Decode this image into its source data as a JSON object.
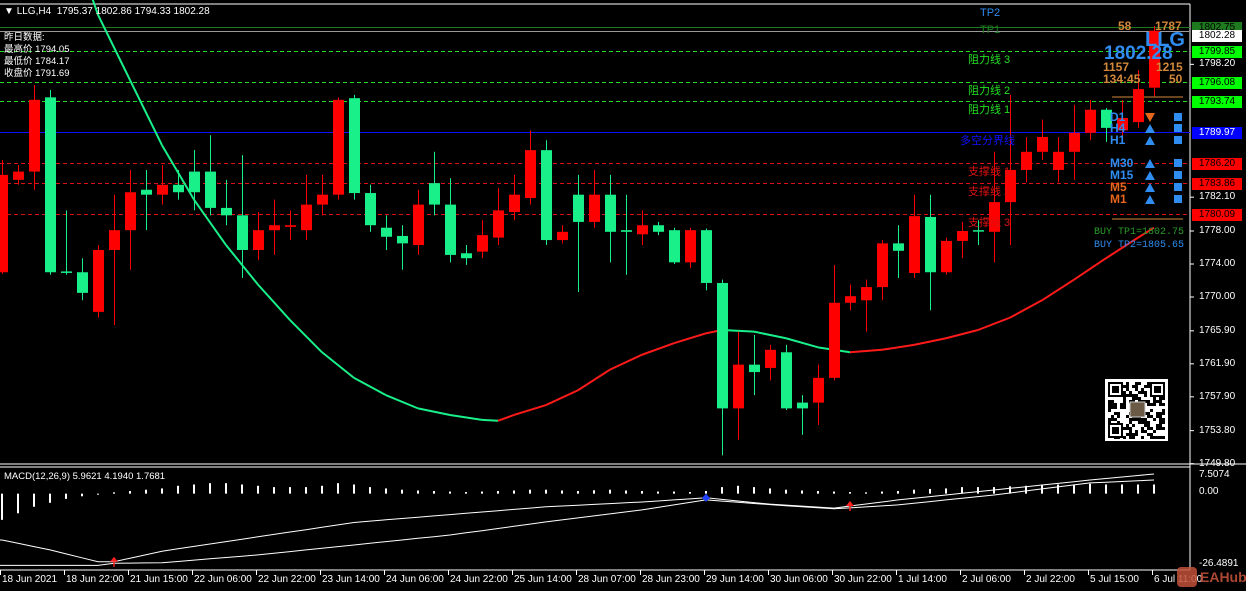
{
  "header": {
    "symbol": "LLG,H4",
    "open": "1795.37",
    "high": "1802.86",
    "low": "1794.33",
    "close": "1802.28"
  },
  "yesterday": {
    "title": "昨日数据:",
    "high": "最高价 1794.05",
    "low": "最低价 1784.17",
    "close": "收盘价 1791.69"
  },
  "levels": [
    {
      "label": "TP2",
      "price": 1805.65,
      "color": "#2f8cf0",
      "line": false,
      "axis_label": null
    },
    {
      "label": "TP1",
      "price": 1802.75,
      "color": "#1e7a1e",
      "line": "solid",
      "axis_label": "1802.75",
      "box": "#1e7a1e"
    },
    {
      "label": "",
      "price": 1802.28,
      "color": "#9a9a9a",
      "line": "solid",
      "axis_label": "1802.28",
      "box": "#ffffff"
    },
    {
      "label": "阻力线 3",
      "price": 1799.85,
      "color": "#22dd22",
      "line": "dashed",
      "axis_label": "1799.85",
      "box": "#00ff00"
    },
    {
      "label": "阻力线 2",
      "price": 1796.08,
      "color": "#22dd22",
      "line": "dashed",
      "axis_label": "1796.08",
      "box": "#00ff00"
    },
    {
      "label": "阻力线 1",
      "price": 1793.74,
      "color": "#22dd22",
      "line": "dashed",
      "axis_label": "1793.74",
      "box": "#00ff00"
    },
    {
      "label": "多空分界线",
      "price": 1789.97,
      "color": "#1010ff",
      "line": "solid",
      "axis_label": "1789.97",
      "box": "#0000ff"
    },
    {
      "label": "支撑线 1",
      "price": 1786.2,
      "color": "#dd1111",
      "line": "dashed",
      "axis_label": "1786.20",
      "box": "#ff0000"
    },
    {
      "label": "支撑线 2",
      "price": 1783.86,
      "color": "#dd1111",
      "line": "dashed",
      "axis_label": "1783.86",
      "box": "#ff0000"
    },
    {
      "label": "支撑线 3",
      "price": 1780.09,
      "color": "#dd1111",
      "line": "dashed",
      "axis_label": "1780.09",
      "box": "#ff0000"
    }
  ],
  "price_axis": [
    "1798.20",
    "1782.10",
    "1778.00",
    "1774.00",
    "1770.00",
    "1765.90",
    "1761.90",
    "1757.90",
    "1753.80",
    "1749.80"
  ],
  "info_panel": {
    "symbol": "LLG",
    "price": "1802.28",
    "n1": "58",
    "n2": "1787",
    "n3": "1157",
    "n4": "1215",
    "timer": "134:45",
    "n5": "50"
  },
  "timeframes": [
    {
      "label": "D1",
      "color": "#2f8cf0",
      "dir": "down",
      "arrow_color": "#e8661c"
    },
    {
      "label": "H4",
      "color": "#2f8cf0",
      "dir": "up",
      "arrow_color": "#2f8cf0"
    },
    {
      "label": "H1",
      "color": "#2f8cf0",
      "dir": "up",
      "arrow_color": "#2f8cf0"
    },
    {
      "label": "M30",
      "color": "#2f8cf0",
      "dir": "up",
      "arrow_color": "#2f8cf0"
    },
    {
      "label": "M15",
      "color": "#2f8cf0",
      "dir": "up",
      "arrow_color": "#2f8cf0"
    },
    {
      "label": "M5",
      "color": "#e8661c",
      "dir": "up",
      "arrow_color": "#2f8cf0"
    },
    {
      "label": "M1",
      "color": "#e8661c",
      "dir": "up",
      "arrow_color": "#2f8cf0"
    }
  ],
  "buy_tp": {
    "tp1": "BUY TP1=1802.75",
    "tp2": "BUY TP2=1805.65"
  },
  "macd": {
    "title": "MACD(12,26,9) 5.9621 4.1940 1.7681",
    "axis_top": "7.5074",
    "axis_zero": "0.00",
    "axis_bottom": "-26.4891"
  },
  "time_axis": [
    "18 Jun 2021",
    "18 Jun 22:00",
    "21 Jun 15:00",
    "22 Jun 06:00",
    "22 Jun 22:00",
    "23 Jun 14:00",
    "24 Jun 06:00",
    "24 Jun 22:00",
    "25 Jun 14:00",
    "28 Jun 07:00",
    "28 Jun 23:00",
    "29 Jun 14:00",
    "30 Jun 06:00",
    "30 Jun 22:00",
    "1 Jul 14:00",
    "2 Jul 06:00",
    "2 Jul 22:00",
    "5 Jul 15:00",
    "6 Jul 11:00"
  ],
  "watermark": "EAHub",
  "colors": {
    "bull": "#ff0000",
    "bear": "#19f08a",
    "ma_up": "#ff1a1a",
    "ma_down": "#19f08a"
  },
  "chart_data": {
    "type": "candlestick",
    "symbol": "LLG",
    "timeframe": "H4",
    "ylim": [
      1749.8,
      1804.0
    ],
    "candles_ohlc": [
      [
        1773.0,
        1786.6,
        1772.8,
        1784.8
      ],
      [
        1784.2,
        1786.0,
        1783.6,
        1785.2
      ],
      [
        1785.2,
        1795.7,
        1783.0,
        1793.9
      ],
      [
        1794.2,
        1795.1,
        1772.7,
        1773.0
      ],
      [
        1773.1,
        1780.5,
        1772.7,
        1773.0
      ],
      [
        1773.0,
        1774.7,
        1769.6,
        1770.5
      ],
      [
        1768.2,
        1776.3,
        1767.5,
        1775.7
      ],
      [
        1775.7,
        1782.4,
        1766.6,
        1778.1
      ],
      [
        1778.1,
        1785.4,
        1773.3,
        1782.7
      ],
      [
        1783.0,
        1785.4,
        1778.1,
        1782.4
      ],
      [
        1782.4,
        1786.0,
        1781.2,
        1783.6
      ],
      [
        1783.6,
        1785.4,
        1781.8,
        1782.7
      ],
      [
        1785.2,
        1787.8,
        1780.5,
        1782.7
      ],
      [
        1785.2,
        1789.6,
        1779.9,
        1780.8
      ],
      [
        1780.8,
        1784.2,
        1778.7,
        1779.9
      ],
      [
        1779.9,
        1787.2,
        1772.3,
        1775.7
      ],
      [
        1775.7,
        1780.3,
        1774.5,
        1778.1
      ],
      [
        1778.1,
        1781.8,
        1775.1,
        1778.7
      ],
      [
        1778.5,
        1780.5,
        1776.9,
        1778.7
      ],
      [
        1778.1,
        1784.8,
        1776.9,
        1781.2
      ],
      [
        1781.2,
        1784.8,
        1779.9,
        1782.4
      ],
      [
        1782.4,
        1794.2,
        1781.8,
        1793.9
      ],
      [
        1794.1,
        1794.5,
        1781.8,
        1782.6
      ],
      [
        1782.6,
        1783.6,
        1777.9,
        1778.7
      ],
      [
        1778.4,
        1779.9,
        1775.7,
        1777.3
      ],
      [
        1777.4,
        1778.7,
        1773.3,
        1776.5
      ],
      [
        1776.3,
        1783.0,
        1775.1,
        1781.2
      ],
      [
        1783.8,
        1787.6,
        1779.9,
        1781.2
      ],
      [
        1781.2,
        1784.4,
        1774.2,
        1775.1
      ],
      [
        1775.3,
        1776.3,
        1773.9,
        1774.7
      ],
      [
        1775.5,
        1779.3,
        1774.7,
        1777.5
      ],
      [
        1777.2,
        1783.2,
        1776.3,
        1780.5
      ],
      [
        1780.3,
        1784.8,
        1779.3,
        1782.4
      ],
      [
        1782.0,
        1790.2,
        1781.2,
        1787.8
      ],
      [
        1787.8,
        1789.0,
        1776.3,
        1776.9
      ],
      [
        1776.9,
        1778.7,
        1776.5,
        1777.9
      ],
      [
        1782.4,
        1784.8,
        1770.6,
        1779.1
      ],
      [
        1779.1,
        1785.4,
        1778.4,
        1782.4
      ],
      [
        1782.4,
        1784.8,
        1774.2,
        1777.9
      ],
      [
        1778.1,
        1782.4,
        1772.7,
        1777.9
      ],
      [
        1777.6,
        1780.5,
        1776.3,
        1778.7
      ],
      [
        1778.7,
        1779.1,
        1777.5,
        1777.9
      ],
      [
        1778.1,
        1778.4,
        1774.0,
        1774.2
      ],
      [
        1774.2,
        1778.4,
        1773.5,
        1778.1
      ],
      [
        1778.1,
        1778.3,
        1770.8,
        1771.7
      ],
      [
        1771.7,
        1772.1,
        1750.8,
        1756.5
      ],
      [
        1756.5,
        1765.8,
        1752.7,
        1761.8
      ],
      [
        1761.8,
        1765.4,
        1758.1,
        1760.9
      ],
      [
        1761.4,
        1764.2,
        1759.9,
        1763.6
      ],
      [
        1763.3,
        1764.2,
        1756.3,
        1756.5
      ],
      [
        1757.2,
        1758.1,
        1753.3,
        1756.5
      ],
      [
        1757.2,
        1761.8,
        1754.5,
        1760.2
      ],
      [
        1760.2,
        1773.9,
        1759.9,
        1769.3
      ],
      [
        1769.3,
        1771.5,
        1768.4,
        1770.1
      ],
      [
        1769.6,
        1772.1,
        1765.8,
        1771.2
      ],
      [
        1771.2,
        1776.9,
        1769.6,
        1776.5
      ],
      [
        1776.5,
        1778.7,
        1772.3,
        1775.6
      ],
      [
        1772.9,
        1782.4,
        1772.3,
        1779.8
      ],
      [
        1779.7,
        1782.4,
        1768.4,
        1773.0
      ],
      [
        1773.0,
        1777.2,
        1772.7,
        1776.8
      ],
      [
        1776.8,
        1779.1,
        1774.7,
        1778.0
      ],
      [
        1778.1,
        1779.3,
        1776.3,
        1778.0
      ],
      [
        1777.9,
        1787.6,
        1774.2,
        1781.5
      ],
      [
        1781.5,
        1794.5,
        1776.3,
        1785.4
      ],
      [
        1785.4,
        1789.4,
        1783.9,
        1787.6
      ],
      [
        1787.6,
        1791.5,
        1786.6,
        1789.4
      ],
      [
        1785.4,
        1789.4,
        1783.9,
        1787.6
      ],
      [
        1787.6,
        1793.3,
        1784.2,
        1789.9
      ],
      [
        1789.9,
        1793.9,
        1789.0,
        1792.7
      ],
      [
        1792.7,
        1792.9,
        1788.8,
        1790.5
      ],
      [
        1790.2,
        1793.9,
        1788.7,
        1791.7
      ],
      [
        1791.2,
        1797.5,
        1790.5,
        1795.2
      ],
      [
        1795.37,
        1802.86,
        1794.33,
        1802.28
      ]
    ],
    "moving_average": [
      [
        5.5,
        1807.0
      ],
      [
        6,
        1804.2
      ],
      [
        8,
        1796.3
      ],
      [
        10,
        1788.4
      ],
      [
        12,
        1781.8
      ],
      [
        14,
        1776.3
      ],
      [
        16,
        1771.5
      ],
      [
        18,
        1767.2
      ],
      [
        20,
        1763.3
      ],
      [
        22,
        1760.2
      ],
      [
        24,
        1758.1
      ],
      [
        26,
        1756.5
      ],
      [
        28,
        1755.7
      ],
      [
        30,
        1755.1
      ],
      [
        31,
        1755.0
      ],
      [
        32,
        1755.7
      ],
      [
        34,
        1756.9
      ],
      [
        36,
        1758.7
      ],
      [
        38,
        1761.2
      ],
      [
        40,
        1763.0
      ],
      [
        42,
        1764.4
      ],
      [
        44,
        1765.6
      ],
      [
        45,
        1766.0
      ],
      [
        47,
        1765.8
      ],
      [
        49,
        1765.0
      ],
      [
        51,
        1763.9
      ],
      [
        53,
        1763.3
      ],
      [
        55,
        1763.6
      ],
      [
        57,
        1764.2
      ],
      [
        59,
        1765.0
      ],
      [
        61,
        1766.0
      ],
      [
        63,
        1767.5
      ],
      [
        65,
        1769.6
      ],
      [
        67,
        1772.1
      ],
      [
        69,
        1774.7
      ],
      [
        71,
        1777.2
      ],
      [
        72,
        1778.4
      ]
    ],
    "macd_histogram": [
      -10,
      -7.5,
      -5,
      -3.5,
      -2,
      -1,
      -0.3,
      0.5,
      1,
      1.5,
      2,
      3,
      3.5,
      4,
      4,
      3.5,
      3,
      2.5,
      2.5,
      2.5,
      3,
      4,
      3.5,
      2.5,
      2,
      1.5,
      1.2,
      1,
      0.8,
      0.6,
      0.8,
      1,
      1.2,
      1.5,
      1.5,
      1.2,
      1,
      1.3,
      1.5,
      1.2,
      1,
      0.8,
      0.8,
      0.6,
      1,
      2.5,
      3,
      2.5,
      2,
      1.5,
      1.2,
      1,
      0.8,
      0.6,
      0.5,
      0.8,
      1,
      1.5,
      1.8,
      2,
      2.5,
      2.5,
      2.5,
      2.8,
      3,
      3.5,
      3.5,
      3.5,
      3.8,
      3.5,
      3.5,
      3.5,
      3.5
    ],
    "macd_line_a": [
      [
        0,
        -17.7
      ],
      [
        3,
        -21.5
      ],
      [
        6,
        -26
      ],
      [
        7,
        -26
      ],
      [
        10,
        -22
      ],
      [
        16,
        -16.5
      ],
      [
        22,
        -11
      ],
      [
        28,
        -8
      ],
      [
        34,
        -5
      ],
      [
        40,
        -3.2
      ],
      [
        44,
        -1.6
      ],
      [
        48,
        -4
      ],
      [
        52,
        -5.5
      ],
      [
        56,
        -2.4
      ],
      [
        62,
        1.4
      ],
      [
        68,
        5.2
      ],
      [
        72,
        7.5
      ]
    ],
    "macd_line_b": [
      [
        0,
        -27.4
      ],
      [
        6,
        -27.4
      ],
      [
        7,
        -26.6
      ],
      [
        10,
        -26.4
      ],
      [
        16,
        -23.4
      ],
      [
        22,
        -19.6
      ],
      [
        28,
        -15.8
      ],
      [
        34,
        -10.8
      ],
      [
        40,
        -6.2
      ],
      [
        44,
        -2.4
      ],
      [
        48,
        -4.2
      ],
      [
        52,
        -5.8
      ],
      [
        56,
        -4.3
      ],
      [
        62,
        -0.5
      ],
      [
        68,
        4.1
      ],
      [
        72,
        5.2
      ]
    ],
    "macd_signals": [
      {
        "index": 7,
        "type": "buy",
        "color": "#ff2020"
      },
      {
        "index": 44,
        "type": "cross",
        "color": "#2040ff"
      },
      {
        "index": 53,
        "type": "buy",
        "color": "#ff2020"
      }
    ],
    "macd_ylim": [
      -26.4891,
      7.5074
    ]
  }
}
